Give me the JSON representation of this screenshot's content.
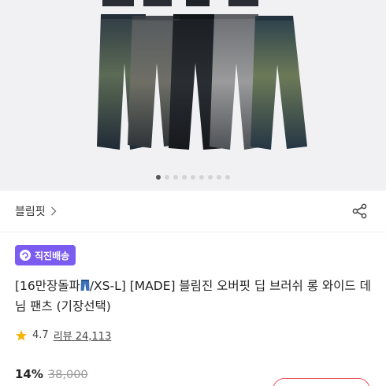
{
  "gallery": {
    "dot_count": 9,
    "active_index": 0
  },
  "store": {
    "name": "블림핏"
  },
  "shipping_badge": {
    "label": "직진배송",
    "color": "#7b5cf0"
  },
  "product": {
    "title_part1": "[16만장돌파",
    "title_part2": "/XS-L] [MADE] 블림진 오버핏 딥 브러쉬 롱 와이드 데님 팬츠 (기장선택)"
  },
  "rating": {
    "score": "4.7",
    "reviews_label": "리뷰 24,113"
  },
  "price": {
    "discount": "14%",
    "original": "38,000"
  },
  "coupon_button": {
    "color": "#f04f5f"
  }
}
